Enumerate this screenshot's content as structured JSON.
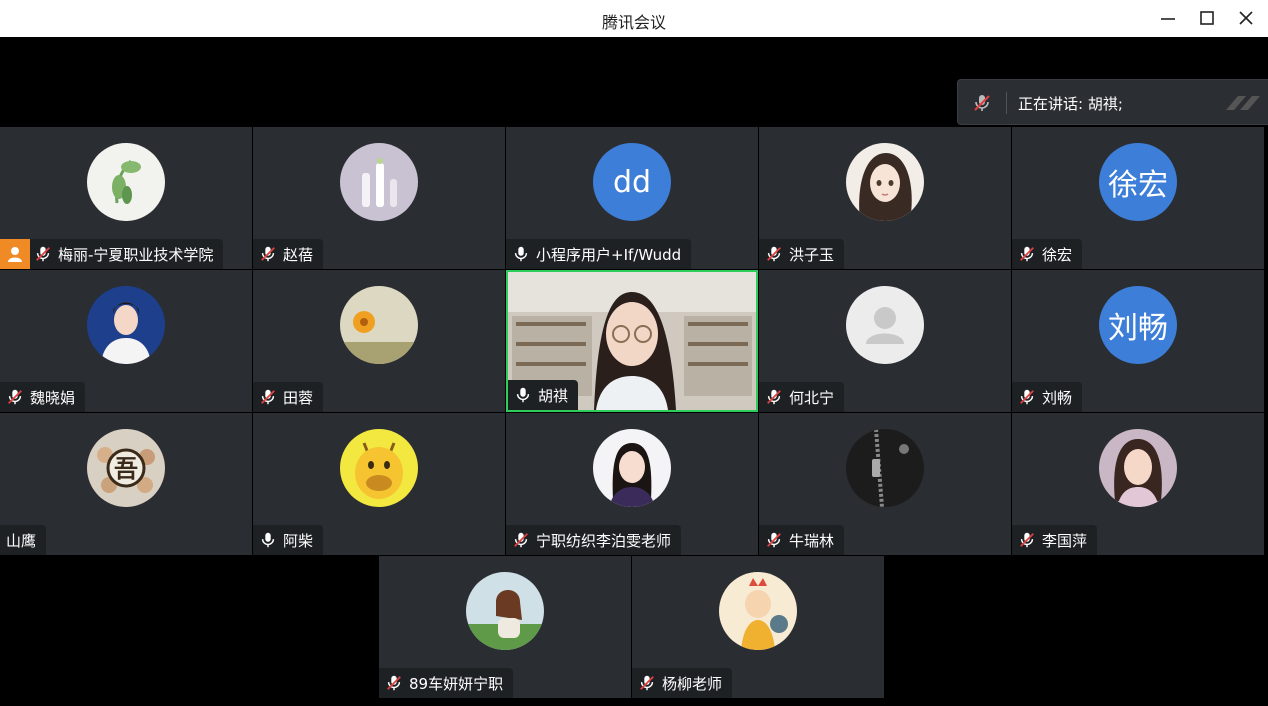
{
  "app": {
    "title": "腾讯会议"
  },
  "speaking": {
    "text": "正在讲话:  胡祺;"
  },
  "participants": [
    {
      "name": "梅丽-宁夏职业技术学院",
      "mic": "muted",
      "host": true,
      "avatar": "plant-photo"
    },
    {
      "name": "赵蓓",
      "mic": "muted",
      "avatar": "vase-photo"
    },
    {
      "name": "小程序用户+If/Wudd",
      "mic": "on",
      "avatar": "initials",
      "initials": "dd"
    },
    {
      "name": "洪子玉",
      "mic": "muted",
      "avatar": "cartoon-girl"
    },
    {
      "name": "徐宏",
      "mic": "muted",
      "avatar": "initials",
      "initials": "徐宏"
    },
    {
      "name": "魏晓娟",
      "mic": "muted",
      "avatar": "portrait-photo"
    },
    {
      "name": "田蓉",
      "mic": "muted",
      "avatar": "flower-photo"
    },
    {
      "name": "胡祺",
      "mic": "on",
      "avatar": "video",
      "speaking": true
    },
    {
      "name": "何北宁",
      "mic": "muted",
      "avatar": "default-person"
    },
    {
      "name": "刘畅",
      "mic": "muted",
      "avatar": "initials",
      "initials": "刘畅"
    },
    {
      "name": "山鹰",
      "mic": "none",
      "avatar": "group-photo"
    },
    {
      "name": "阿柴",
      "mic": "on",
      "avatar": "giraffe-cartoon"
    },
    {
      "name": "宁职纺织李泊雯老师",
      "mic": "muted",
      "avatar": "portrait-photo-2"
    },
    {
      "name": "牛瑞林",
      "mic": "muted",
      "avatar": "leather-zipper"
    },
    {
      "name": "李国萍",
      "mic": "muted",
      "avatar": "painted-lady"
    },
    {
      "name": "89车妍妍宁职",
      "mic": "muted",
      "avatar": "girl-illustration"
    },
    {
      "name": "杨柳老师",
      "mic": "muted",
      "avatar": "cartoon-statue"
    }
  ],
  "colors": {
    "tile_bg": "#2a2d31",
    "label_bg": "#1e2124",
    "host_badge": "#f08a24",
    "speaking_border": "#2ecc5a",
    "initials_bg": "#3d7ed9",
    "muted_slash": "#e04040"
  }
}
